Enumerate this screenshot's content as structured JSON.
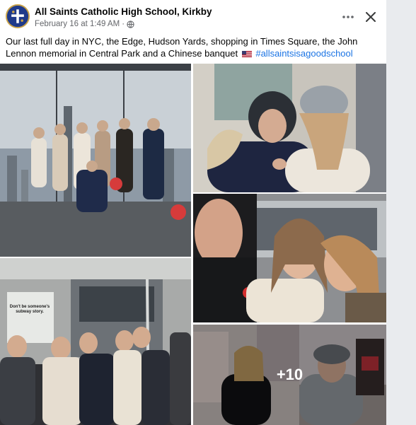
{
  "post": {
    "page_name": "All Saints Catholic High School, Kirkby",
    "date": "February 16 at 1:49 AM",
    "separator": "·",
    "caption_text": "Our last full day in NYC, the Edge, Hudson Yards, shopping in Times Square, the John Lennon memorial in Central Park and a Chinese banquet",
    "hashtag": "#allsaintsisagoodschool"
  },
  "icons": {
    "avatar": "school-crest-icon",
    "privacy": "globe-icon",
    "more": "more-dots-icon",
    "close": "close-icon",
    "flag": "us-flag-emoji"
  },
  "photos": {
    "more_count": "+10",
    "sign_text": "Don't be someone's subway story."
  },
  "colors": {
    "hashtag": "#1b74e4",
    "text": "#050505",
    "meta": "#65676b",
    "crest": "#1f3a8a"
  }
}
